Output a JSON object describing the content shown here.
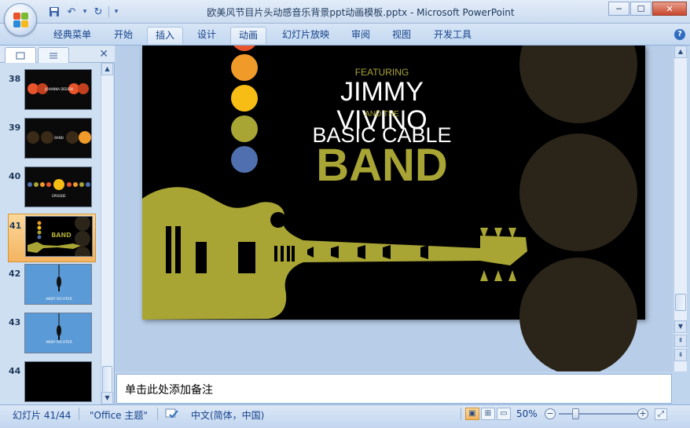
{
  "window": {
    "title": "欧美风节目片头动感音乐背景ppt动画模板.pptx - Microsoft PowerPoint",
    "minimize": "─",
    "maximize": "☐",
    "close": "✕"
  },
  "qat": {
    "save_icon": "save-icon",
    "undo": "↶",
    "redo": "↻",
    "more": "▾"
  },
  "ribbon": {
    "tabs": [
      {
        "label": "经典菜单"
      },
      {
        "label": "开始"
      },
      {
        "label": "插入"
      },
      {
        "label": "设计"
      },
      {
        "label": "动画"
      },
      {
        "label": "幻灯片放映"
      },
      {
        "label": "审阅"
      },
      {
        "label": "视图"
      },
      {
        "label": "开发工具"
      }
    ],
    "help": "?"
  },
  "slides_panel": {
    "close": "✕",
    "thumbnails": [
      {
        "num": "38",
        "caption": "JOHANNA DESIGN"
      },
      {
        "num": "39",
        "caption": "BAND"
      },
      {
        "num": "40",
        "caption": "EPISODE"
      },
      {
        "num": "41",
        "caption": "BAND"
      },
      {
        "num": "42",
        "caption": "ANDY RICHTER"
      },
      {
        "num": "43",
        "caption": "ANDY RICHTER"
      },
      {
        "num": "44",
        "caption": ""
      }
    ]
  },
  "slide": {
    "featuring": "FEATURING",
    "name1": "JIMMY",
    "name2": "VIVINO",
    "and_the": "AND THE",
    "basic_cable": "BASIC CABLE",
    "band": "BAND",
    "colors": {
      "olive": "#a9a535",
      "orange": "#f09a2a",
      "yellow": "#f7bd14",
      "blue": "#4f6fae",
      "dark_circle": "#2b2418"
    }
  },
  "notes": {
    "placeholder": "单击此处添加备注"
  },
  "status": {
    "slide_count": "幻灯片 41/44",
    "theme": "\"Office 主题\"",
    "language": "中文(简体，中国)",
    "zoom": "50%",
    "zoom_out": "−",
    "zoom_in": "+"
  }
}
